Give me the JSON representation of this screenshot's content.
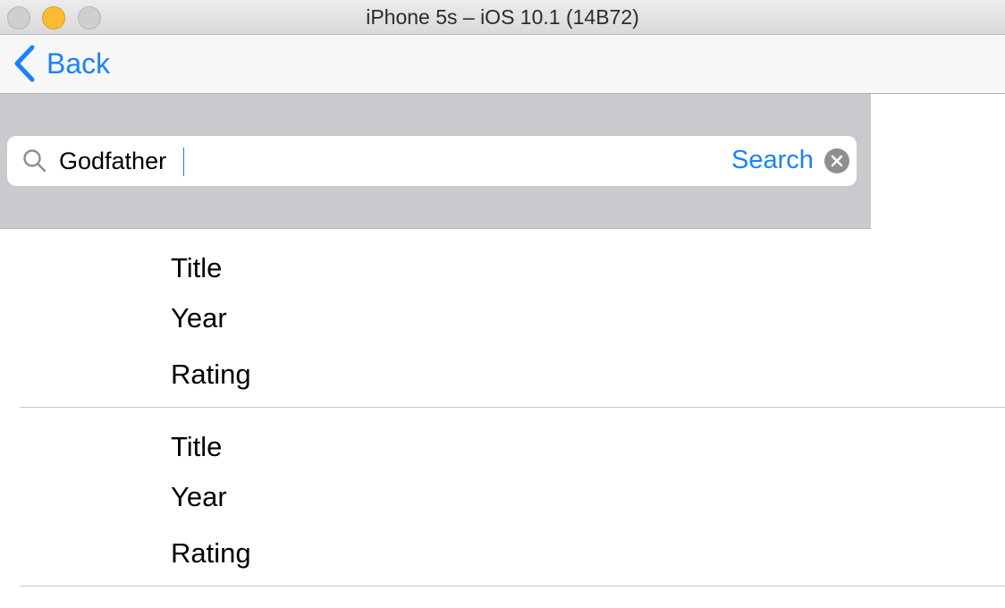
{
  "window": {
    "title": "iPhone 5s – iOS 10.1 (14B72)"
  },
  "navbar": {
    "back_label": "Back"
  },
  "search": {
    "value": "Godfather",
    "button_label": "Search"
  },
  "results": [
    {
      "title": "Title",
      "year": "Year",
      "rating": "Rating"
    },
    {
      "title": "Title",
      "year": "Year",
      "rating": "Rating"
    }
  ],
  "colors": {
    "accent": "#1a82fb",
    "search_bar_bg": "#c9c9ce",
    "clear_icon": "#8e8e93"
  },
  "icons": {
    "back": "chevron-left-icon",
    "search": "magnifier-icon",
    "clear": "clear-circle-x-icon"
  }
}
